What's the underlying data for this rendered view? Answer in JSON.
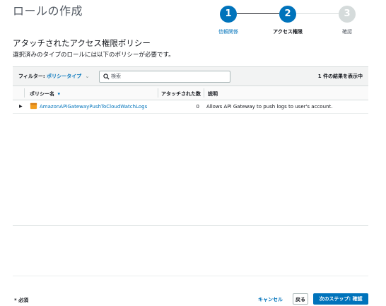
{
  "page": {
    "title": "ロールの作成"
  },
  "stepper": {
    "steps": [
      {
        "number": "1",
        "label": "信頼関係",
        "state": "completed"
      },
      {
        "number": "2",
        "label": "アクセス権限",
        "state": "current"
      },
      {
        "number": "3",
        "label": "確認",
        "state": "future"
      }
    ]
  },
  "section": {
    "heading": "アタッチされたアクセス権限ポリシー",
    "description": "選択済みのタイプのロールには以下のポリシーが必要です。"
  },
  "toolbar": {
    "filter_label": "フィルター:",
    "filter_value": "ポリシータイプ",
    "search_placeholder": "検索",
    "result_count": "1 件の結果を表示中"
  },
  "table": {
    "columns": {
      "policy_name": "ポリシー名",
      "attached_count": "アタッチされた数",
      "description": "説明"
    },
    "rows": [
      {
        "policy_name": "AmazonAPIGatewayPushToCloudWatchLogs",
        "attached_count": "0",
        "description": "Allows API Gateway to push logs to user's account."
      }
    ]
  },
  "footer": {
    "required_note": "* 必須",
    "cancel": "キャンセル",
    "back": "戻る",
    "next": "次のステップ: 確認"
  },
  "colors": {
    "accent": "#0073bb",
    "policy_icon": "#f29d1f"
  }
}
